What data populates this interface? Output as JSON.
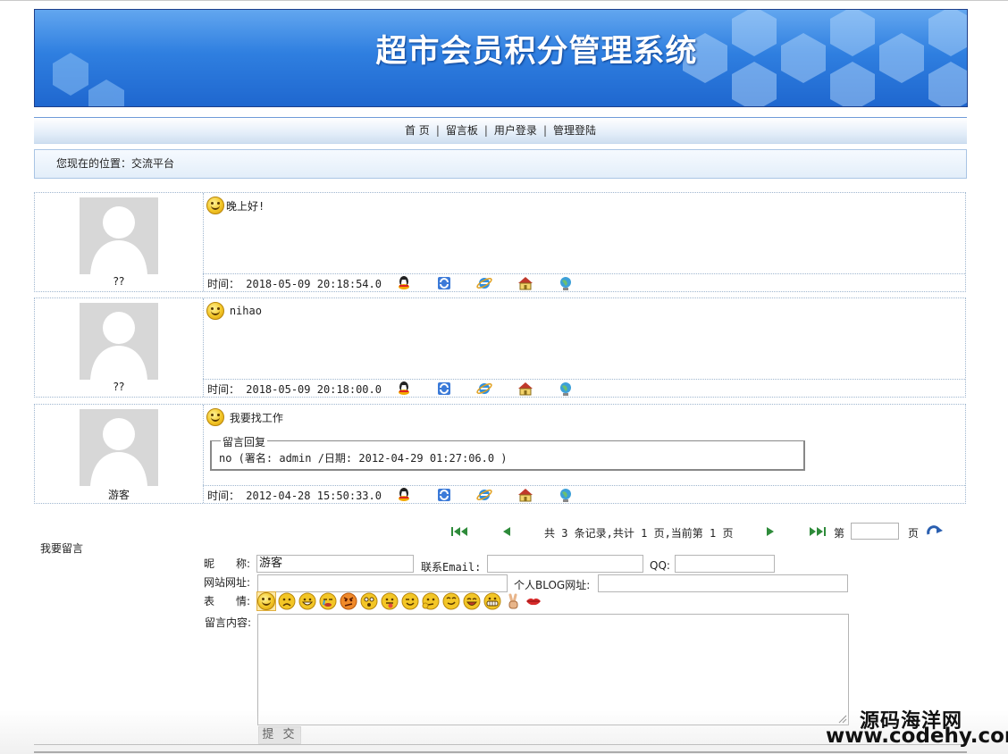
{
  "banner": {
    "title": "超市会员积分管理系统"
  },
  "nav": {
    "items": [
      {
        "label": "首 页"
      },
      {
        "label": "留言板"
      },
      {
        "label": "用户登录"
      },
      {
        "label": "管理登陆"
      }
    ],
    "separator": "|"
  },
  "location": {
    "prefix": "您现在的位置：",
    "current": "交流平台"
  },
  "messages": [
    {
      "user": "??",
      "text": "晚上好!",
      "time_label": "时间：",
      "time": "2018-05-09 20:18:54.0"
    },
    {
      "user": "??",
      "text": "nihao",
      "time_label": "时间：",
      "time": "2018-05-09 20:18:00.0"
    },
    {
      "user": "游客",
      "text": "我要找工作",
      "time_label": "时间：",
      "time": "2012-04-28 15:50:33.0",
      "reply": {
        "legend": "留言回复",
        "text": "no (署名: admin /日期: 2012-04-29 01:27:06.0 )"
      }
    }
  ],
  "meta_icons": [
    "qq-icon",
    "sync-icon",
    "ie-icon",
    "home-icon",
    "globe-icon"
  ],
  "pager": {
    "summary": "共 3 条记录,共计 1 页,当前第 1 页",
    "goto_prefix": "第",
    "goto_suffix": "页",
    "page_value": ""
  },
  "form": {
    "title": "我要留言",
    "nickname_label": "昵　　称:",
    "nickname_value": "游客",
    "email_label": "联系Email:",
    "email_value": "",
    "qq_label": "QQ:",
    "qq_value": "",
    "website_label": "网站网址:",
    "website_value": "",
    "blog_label": "个人BLOG网址:",
    "blog_value": "",
    "emotion_label": "表　　情:",
    "content_label": "留言内容:",
    "submit_label": "提 交",
    "emoticon_count": 14
  },
  "watermark": {
    "line1": "源码海洋网",
    "line2": "www.codehy.com"
  }
}
